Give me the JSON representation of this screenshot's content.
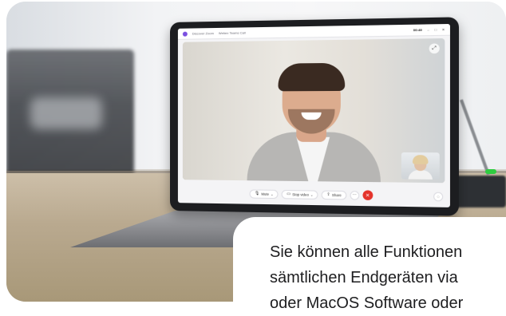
{
  "app": {
    "title": "Discover Zoom",
    "subtitle": "Webex Teams Call",
    "time": "00:40"
  },
  "window_controls": {
    "minimize": "–",
    "maximize": "□",
    "close": "✕"
  },
  "icons": {
    "expand": "expand-icon",
    "mic": "microphone-icon",
    "video": "video-camera-icon",
    "share": "share-icon",
    "more": "more-icon",
    "end": "end-call-icon",
    "chat": "chat-icon"
  },
  "controls": {
    "mute_label": "Mute",
    "stop_video_label": "Stop video",
    "share_label": "Share",
    "more_label": "···",
    "end_label": "✕",
    "chevron": "⌄"
  },
  "colors": {
    "end_call": "#e4332b",
    "app_accent": "#7a4fe0"
  },
  "overlay": {
    "line1": "Sie können alle Funktionen",
    "line2": "sämtlichen Endgeräten via",
    "line3": "oder MacOS Software oder"
  }
}
